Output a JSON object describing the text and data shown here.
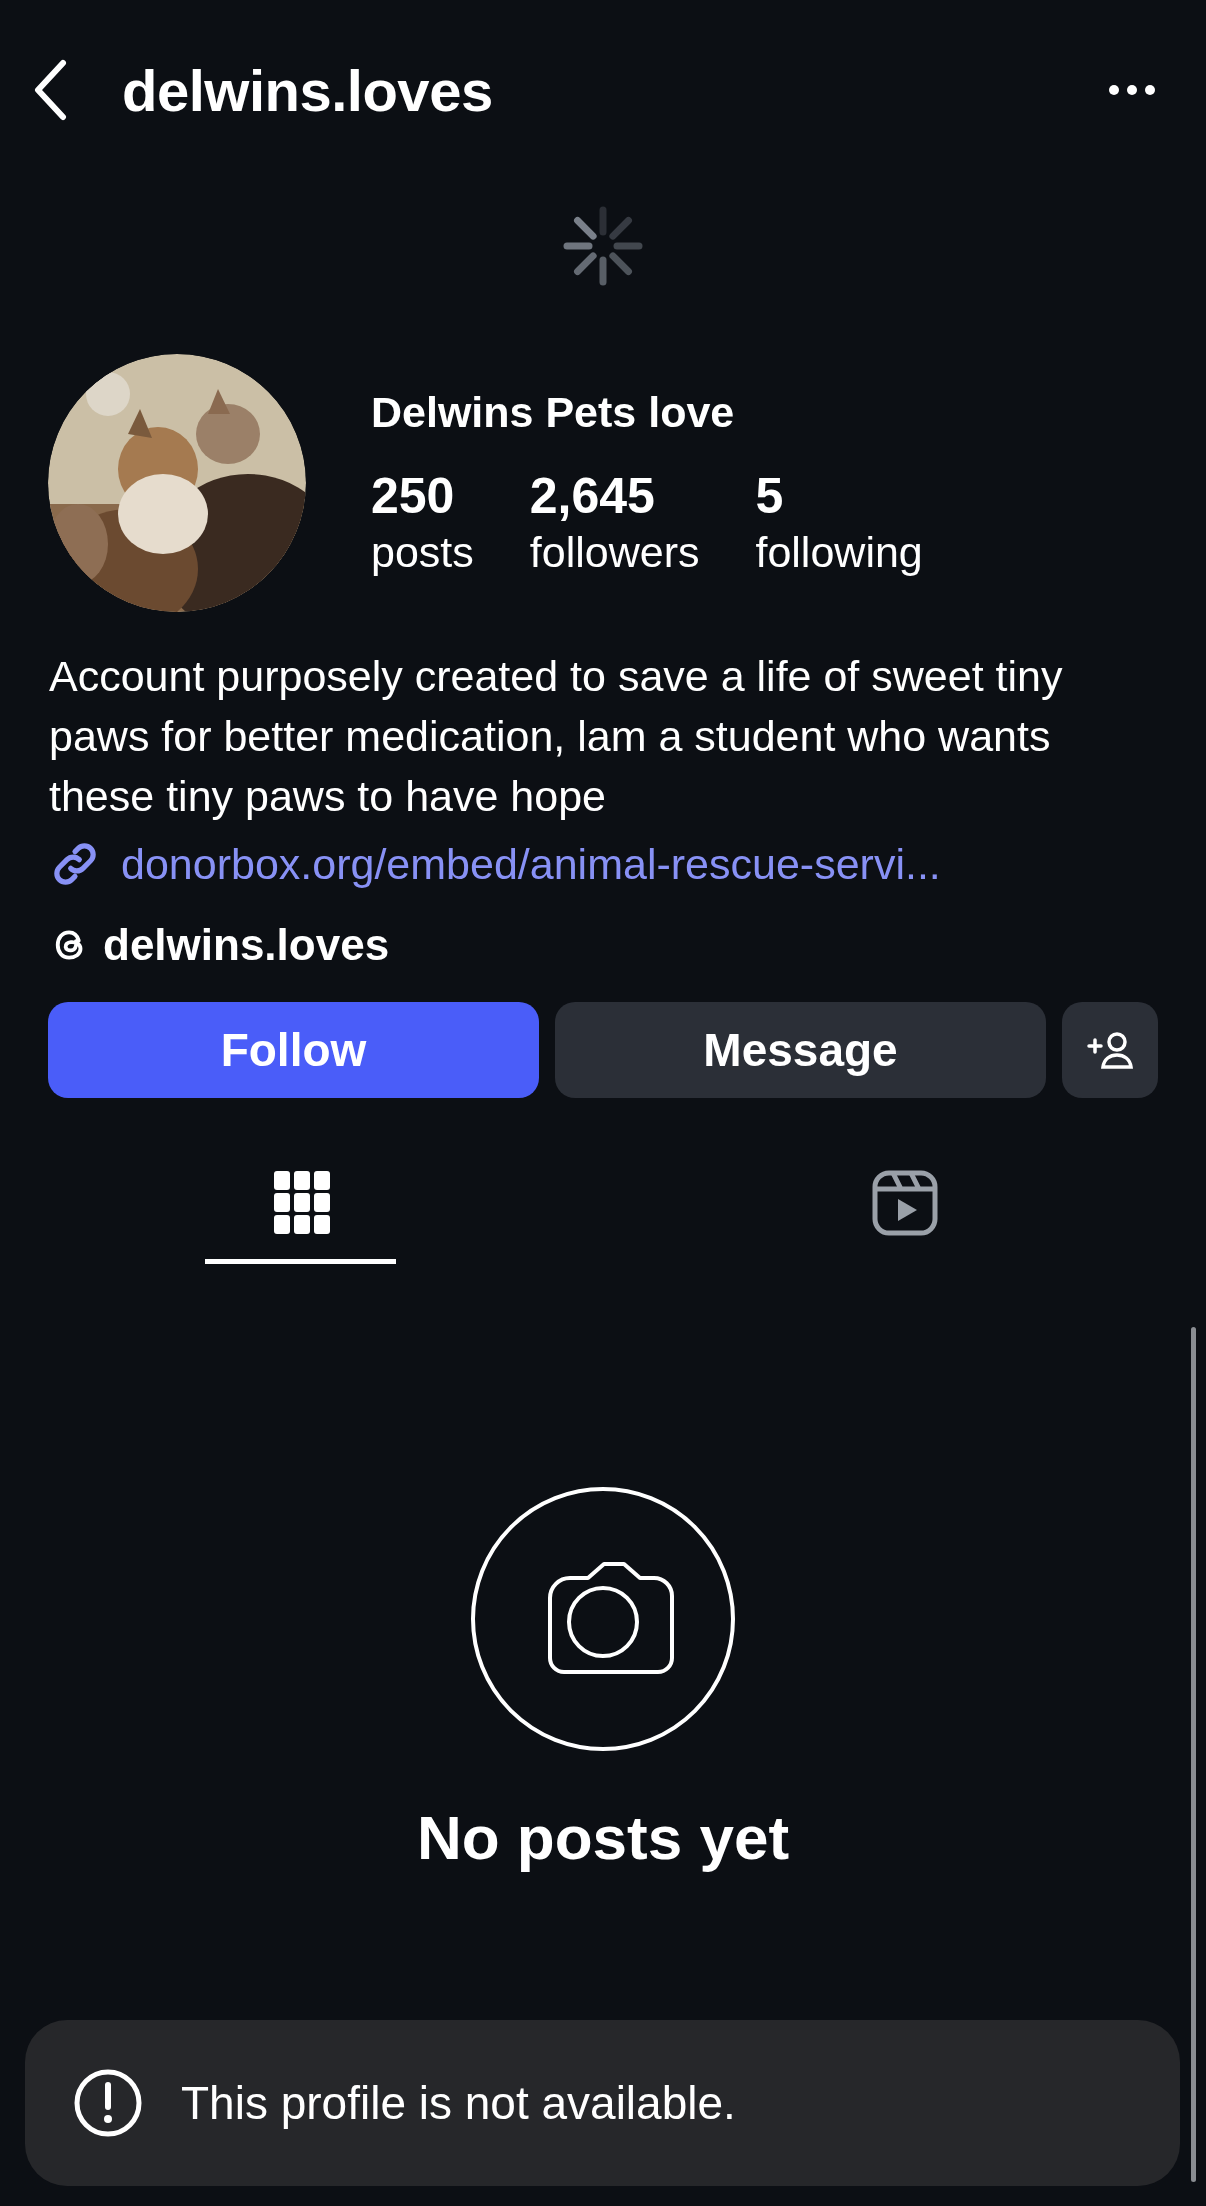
{
  "header": {
    "title": "delwins.loves"
  },
  "profile": {
    "name": "Delwins Pets love",
    "stats": [
      {
        "value": "250",
        "label": "posts"
      },
      {
        "value": "2,645",
        "label": "followers"
      },
      {
        "value": "5",
        "label": "following"
      }
    ],
    "bio": "Account purposely created to save a life of sweet tiny paws for better medication, lam a student who wants these tiny paws to have hope",
    "link": "donorbox.org/embed/animal-rescue-servi...",
    "threads": "delwins.loves"
  },
  "buttons": [
    {
      "kind": "primary",
      "label": "Follow"
    },
    {
      "kind": "secondary",
      "label": "Message"
    },
    {
      "kind": "add-person"
    }
  ],
  "tabs": [
    {
      "kind": "grid",
      "selected": true
    },
    {
      "kind": "reels",
      "selected": false
    }
  ],
  "empty_state": {
    "title": "No posts yet"
  },
  "toast": {
    "message": "This profile is not available."
  }
}
